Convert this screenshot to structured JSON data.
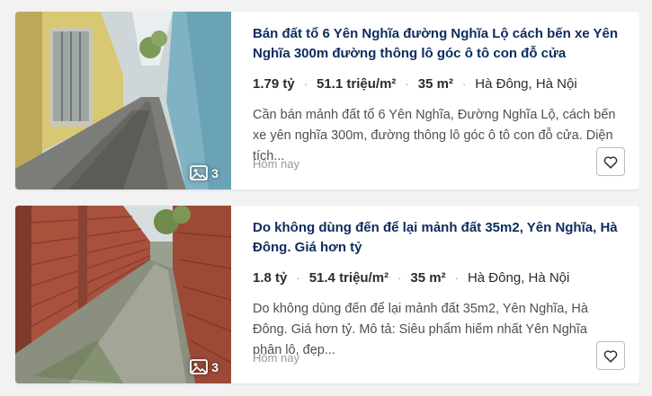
{
  "listings": [
    {
      "title": "Bán đất tổ 6 Yên Nghĩa đường Nghĩa Lộ cách bến xe Yên Nghĩa 300m đường thông lô góc ô tô con đỗ cửa",
      "price": "1.79 tỷ",
      "price_per_m2": "51.1 triệu/m²",
      "area": "35 m²",
      "location": "Hà Đông, Hà Nội",
      "description": "Cần bán mảnh đất tổ 6 Yên Nghĩa, Đường Nghĩa Lộ, cách bến xe yên nghĩa 300m, đường thông lô góc ô tô con đỗ cửa. Diện tích...",
      "posted": "Hôm nay",
      "photo_count": "3",
      "icons": {
        "photos": "image-gallery-icon",
        "favorite": "heart-icon"
      }
    },
    {
      "title": "Do không dùng đến để lại mảnh đất 35m2, Yên Nghĩa, Hà Đông. Giá hơn tỷ",
      "price": "1.8 tỷ",
      "price_per_m2": "51.4 triệu/m²",
      "area": "35 m²",
      "location": "Hà Đông, Hà Nội",
      "description": "Do không dùng đến để lại mảnh đất 35m2, Yên Nghĩa, Hà Đông. Giá hơn tỷ. Mô tả: Siêu phẩm hiếm nhất Yên Nghĩa phân lô, đẹp...",
      "posted": "Hôm nay",
      "photo_count": "3",
      "icons": {
        "photos": "image-gallery-icon",
        "favorite": "heart-icon"
      }
    }
  ],
  "colors": {
    "title": "#0d2c5e",
    "background": "#f2f2f2",
    "card": "#ffffff",
    "muted": "#999999"
  }
}
